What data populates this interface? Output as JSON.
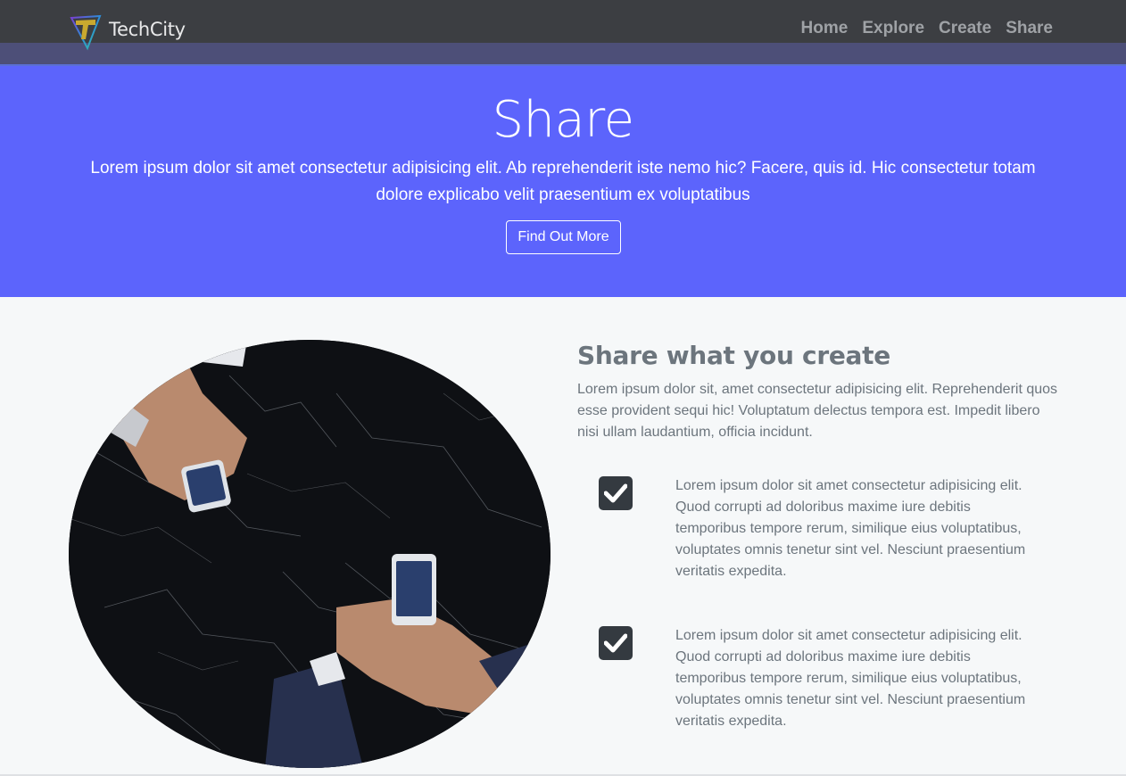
{
  "brand": {
    "name": "TechCity",
    "logo_icon": "techcity-logo-icon"
  },
  "nav": {
    "items": [
      "Home",
      "Explore",
      "Create",
      "Share"
    ]
  },
  "hero": {
    "title": "Share",
    "text": "Lorem ipsum dolor sit amet consectetur adipisicing elit. Ab reprehenderit iste nemo hic? Facere, quis id. Hic consectetur totam dolore explicabo velit praesentium ex voluptatibus",
    "button": "Find Out More"
  },
  "section": {
    "heading": "Share what you create",
    "intro": "Lorem ipsum dolor sit, amet consectetur adipisicing elit. Reprehenderit quos esse provident sequi hic! Voluptatum delectus tempora est. Impedit libero nisi ullam laudantium, officia incidunt.",
    "features": [
      {
        "icon": "checkbox-icon",
        "text": "Lorem ipsum dolor sit amet consectetur adipisicing elit. Quod corrupti ad doloribus maxime iure debitis temporibus tempore rerum, similique eius voluptatibus, voluptates omnis tenetur sint vel. Nesciunt praesentium veritatis expedita."
      },
      {
        "icon": "checkbox-icon",
        "text": "Lorem ipsum dolor sit amet consectetur adipisicing elit. Quod corrupti ad doloribus maxime iure debitis temporibus tempore rerum, similique eius voluptatibus, voluptates omnis tenetur sint vel. Nesciunt praesentium veritatis expedita."
      }
    ]
  },
  "colors": {
    "navbar": "#3c3e42",
    "hero": "#5c64fc",
    "body": "#f6f8f9",
    "text_muted": "#6c757d",
    "check_bg": "#343a40"
  }
}
